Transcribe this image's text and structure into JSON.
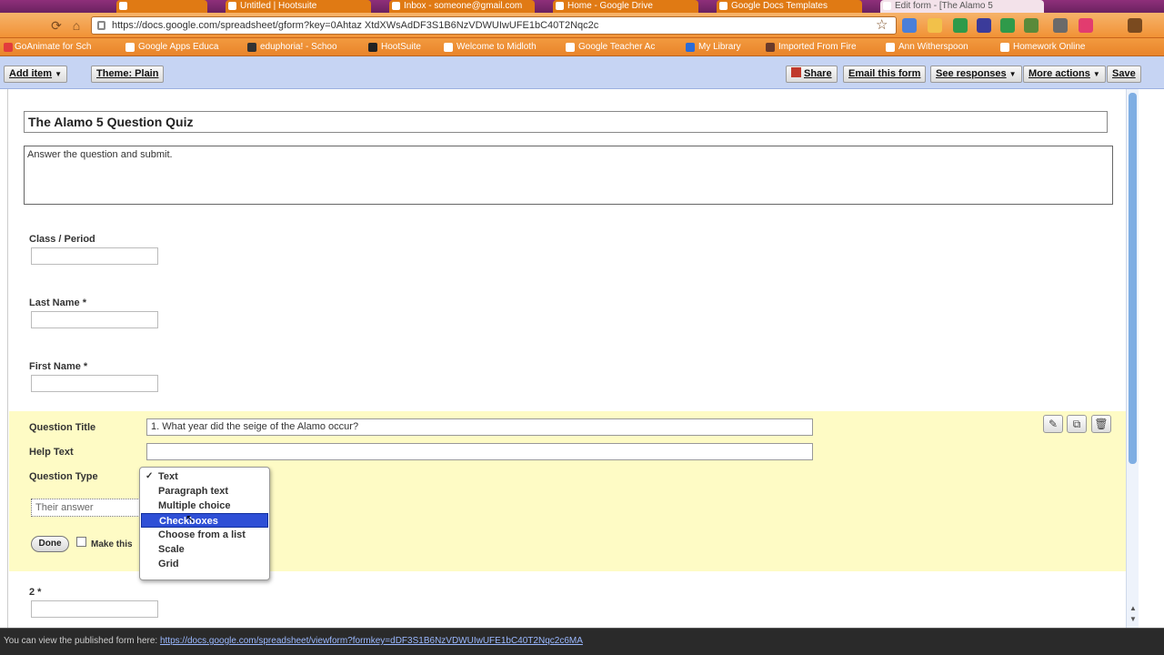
{
  "browser": {
    "tabs": [
      {
        "label": "",
        "active": false
      },
      {
        "label": "Untitled | Hootsuite",
        "active": false
      },
      {
        "label": "Inbox - someone@gmail.com",
        "active": false
      },
      {
        "label": "Home - Google Drive",
        "active": false
      },
      {
        "label": "Google Docs Templates",
        "active": false
      },
      {
        "label": "Edit form - [The Alamo 5 ",
        "active": true
      }
    ],
    "url": "https://docs.google.com/spreadsheet/gform?key=0Ahtaz XtdXWsAdDF3S1B6NzVDWUIwUFE1bC40T2Nqc2c",
    "bookmarks": [
      "GoAnimate for Sch",
      "Google Apps Educa",
      "eduphoria! - Schoo",
      "HootSuite",
      "Welcome to Midloth",
      "Google Teacher Ac",
      "My Library",
      "Imported From Fire",
      "Ann Witherspoon",
      "Homework Online"
    ]
  },
  "appbar": {
    "add_item": "Add item",
    "theme": "Theme: Plain",
    "share": "Share",
    "email_form": "Email this form",
    "see_responses": "See responses",
    "more_actions": "More actions",
    "save": "Save"
  },
  "form": {
    "title": "The Alamo 5 Question Quiz",
    "description": "Answer the question and submit.",
    "fields": [
      {
        "label": "Class / Period"
      },
      {
        "label": "Last Name *"
      },
      {
        "label": "First Name *"
      }
    ]
  },
  "editor": {
    "question_title_label": "Question Title",
    "question_title_value": "1. What year did the seige of the Alamo occur?",
    "help_text_label": "Help Text",
    "help_text_value": "",
    "question_type_label": "Question Type",
    "their_answer": "Their answer",
    "done": "Done",
    "make_required": "Make this",
    "type_options": [
      {
        "label": "Text",
        "checked": true
      },
      {
        "label": "Paragraph text"
      },
      {
        "label": "Multiple choice"
      },
      {
        "label": "Checkboxes",
        "highlighted": true
      },
      {
        "label": "Choose from a list"
      },
      {
        "label": "Scale"
      },
      {
        "label": "Grid"
      }
    ]
  },
  "next_question": {
    "label": "2 *"
  },
  "status": {
    "prefix": "You can view the published form here:",
    "link": "https://docs.google.com/spreadsheet/viewform?formkey=dDF3S1B6NzVDWUIwUFE1bC40T2Nqc2c6MA"
  }
}
